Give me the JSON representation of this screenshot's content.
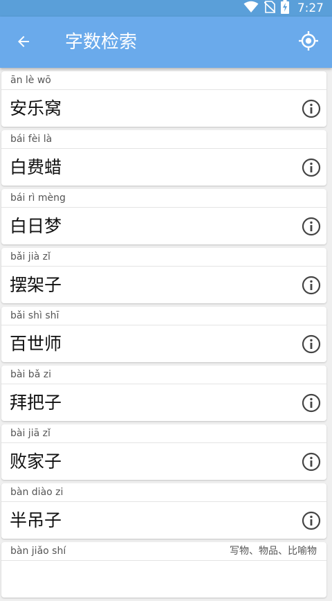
{
  "status_bar": {
    "time": "7:27",
    "icons": [
      "wifi-icon",
      "no-sim-icon",
      "battery-charging-icon"
    ]
  },
  "app_bar": {
    "title": "字数检索",
    "back_icon": "arrow-left-icon",
    "action_icon": "gps-locate-icon"
  },
  "colors": {
    "status_bar": "#5a9fd9",
    "app_bar": "#6aaaeb",
    "background": "#efefef",
    "card": "#ffffff",
    "icon": "#444444"
  },
  "list": {
    "items": [
      {
        "pinyin": "ān lè wō",
        "word": "安乐窝",
        "meaning": ""
      },
      {
        "pinyin": "bái fèi là",
        "word": "白费蜡",
        "meaning": ""
      },
      {
        "pinyin": "bái rì mèng",
        "word": "白日梦",
        "meaning": ""
      },
      {
        "pinyin": "bǎi jià zǐ",
        "word": "摆架子",
        "meaning": ""
      },
      {
        "pinyin": "bǎi shì shī",
        "word": "百世师",
        "meaning": ""
      },
      {
        "pinyin": "bài bǎ zi",
        "word": "拜把子",
        "meaning": ""
      },
      {
        "pinyin": "bài jiā zǐ",
        "word": "败家子",
        "meaning": ""
      },
      {
        "pinyin": "bàn diào zi",
        "word": "半吊子",
        "meaning": ""
      },
      {
        "pinyin": "bàn jiǎo shí",
        "word": "",
        "meaning": "写物、物品、比喻物"
      }
    ]
  }
}
